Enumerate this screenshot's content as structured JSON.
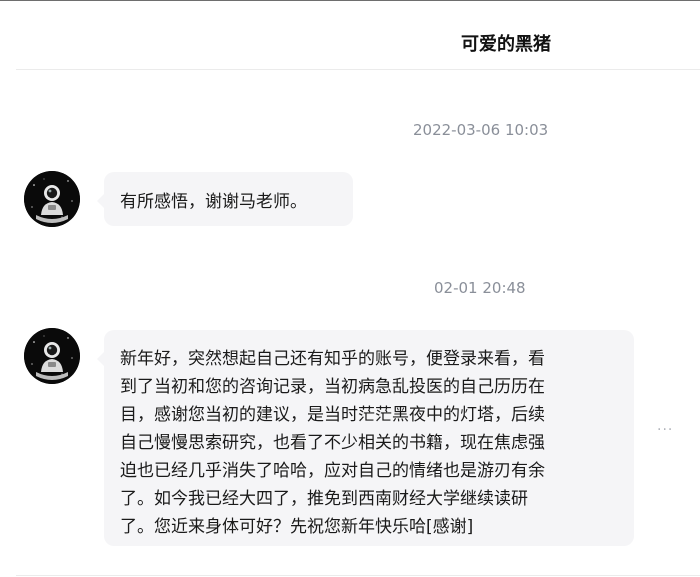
{
  "conversation": {
    "title": "可爱的黑猪"
  },
  "messages": [
    {
      "timestamp": "2022-03-06 10:03",
      "avatar": "astronaut-avatar",
      "lines": [
        "有所感悟，谢谢马老师。"
      ]
    },
    {
      "timestamp": "02-01 20:48",
      "avatar": "astronaut-avatar",
      "lines": [
        "新年好，突然想起自己还有知乎的账号，便登录来看，看",
        "到了当初和您的咨询记录，当初病急乱投医的自己历历在",
        "目，感谢您当初的建议，是当时茫茫黑夜中的灯塔，后续",
        "自己慢慢思索研究，也看了不少相关的书籍，现在焦虑强",
        "迫也已经几乎消失了哈哈，应对自己的情绪也是游刃有余",
        "了。如今我已经大四了，推免到西南财经大学继续读研",
        "了。您近来身体可好？先祝您新年快乐哈[感谢]"
      ]
    }
  ],
  "icons": {
    "more": "more-horizontal-icon"
  },
  "colors": {
    "bubble_bg": "#f5f5f7",
    "timestamp": "#8a8f99",
    "title": "#121212"
  }
}
